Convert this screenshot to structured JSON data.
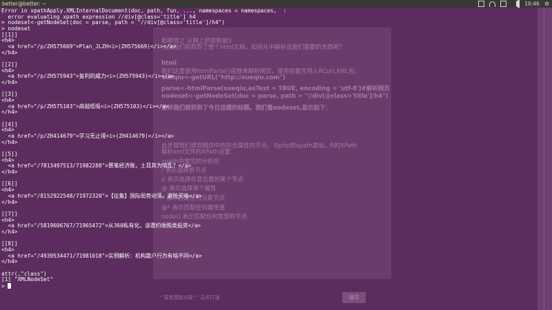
{
  "window": {
    "title": "better@better: ~",
    "tray_icons": [
      "mail-icon",
      "wifi-icon",
      "battery-icon",
      "volume-icon"
    ],
    "clock": "10:46"
  },
  "background_page": {
    "heading": "和朋简之 从网上抓取数据3",
    "lines": [
      "上文我们获取到了整个html文档，如何从中解析出我们需要的东西呢？",
      "html",
      "我们这里使用htmlParse()函数来解析网页，使用前要先导入RCurl,XML包，",
      "xueqiu<-getURL(\"http://xueqiu.com\")",
      "parse<-htmlParse(xueqiu,asText = TRUE, encoding = 'utf-8')#解析网页",
      "nodeset<-getNodeSet(doc = parse, path = \"//div[@class='title']/h4\")",
      "这样我们就抓到了今日话题的标题。我们看nodeset,显示如下：",
      "此步骤我们得到网页中的符合属性的节点，与php的xpath类似，R的XPath",
      "解析xml文件的XPath设置：",
      "xpath中常见的分析符",
      "/ 表示选择根节点",
      "// 表示选择任意位置的某个节点",
      "@ 表示选择某个属性",
      "* 表示匹配任何元素节点",
      "@* 表示匹配任何属性值",
      "node() 表示匹配任何类型的节点"
    ],
    "editor_hint": "\" 富有围绕对象\"  \" 元件打通",
    "submit_label": "提交"
  },
  "terminal": {
    "lines": [
      "Error in xpathApply.XMLInternalDocument(doc, path, fun, ..., namespaces = namespaces,  :",
      "  error evaluating xpath expression //div[@class='title'] h4",
      "> nodeset<-getNodeSet(doc = parse, path = \"//div[@class='title']/h4\")",
      "> nodeset",
      "[[1]]",
      "<h4>",
      "  <a href=\"/p/ZH575669\">Plan_JLZH<i>(ZH575669)</i></a>",
      "</h4>",
      "",
      "[[2]]",
      "<h4>",
      "  <a href=\"/p/ZH575943\">复利的威力<i>(ZH575943)</i></a>",
      "</h4>",
      "",
      "[[3]]",
      "<h4>",
      "  <a href=\"/p/ZH575103\">高抛低吸<i>(ZH575103)</i></a>",
      "</h4>",
      "",
      "[[4]]",
      "<h4>",
      "  <a href=\"/p/ZH414679\">学习无止境<i>(ZH414679)</i></a>",
      "</h4>",
      "",
      "[[5]]",
      "<h4>",
      "  <a href=\"/7813497513/71982288\">算笔经济账，土耳其为啥乱？</a>",
      "</h4>",
      "",
      "[[6]]",
      "<h4>",
      "  <a href=\"/8152922548/71972320\">【征集】国际局势动荡，避险买啥</a>",
      "</h4>",
      "",
      "[[7]]",
      "<h4>",
      "  <a href=\"/5819606767/71965472\">从360私有化，谈邀约收购类投资</a>",
      "</h4>",
      "",
      "[[8]]",
      "<h4>",
      "  <a href=\"/4939534471/71981018\">实例解析：机构散户行为有啥不同</a>",
      "</h4>",
      "",
      "attr(,\"class\")",
      "[1] \"XMLNodeSet\""
    ],
    "prompt": "> "
  }
}
